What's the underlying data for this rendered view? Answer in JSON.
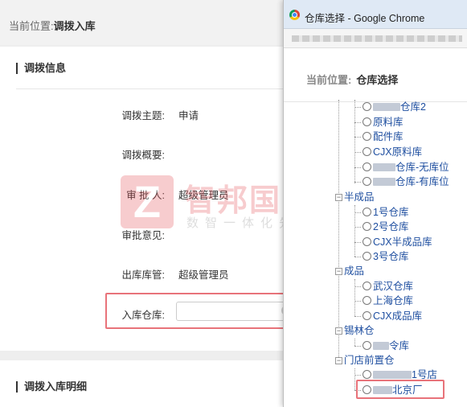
{
  "breadcrumb": {
    "prefix": "当前位置:",
    "current": "调拨入库"
  },
  "section1": {
    "title": "调拨信息"
  },
  "form": [
    {
      "label": "调拨主题:",
      "value": "申请"
    },
    {
      "label": "调拨概要:",
      "value": ""
    },
    {
      "label": "审 批 人:",
      "value": "超级管理员"
    },
    {
      "label": "审批意见:",
      "value": ""
    },
    {
      "label": "出库库管:",
      "value": "超级管理员"
    },
    {
      "label": "入库仓库:",
      "value": ""
    }
  ],
  "section2": {
    "title": "调拨入库明细"
  },
  "watermark": {
    "logo": "Z",
    "name": "智邦国际",
    "slogan": "数智一体化先行者"
  },
  "popup": {
    "window_title": "仓库选择 - Google Chrome",
    "crumb_prefix": "当前位置:",
    "crumb_current": "仓库选择",
    "tree": {
      "g0_items": [
        "仓库2",
        "原料库",
        "配件库",
        "CJX原料库",
        "仓库-无库位",
        "仓库-有库位"
      ],
      "g1_name": "半成品",
      "g1_items": [
        "1号仓库",
        "2号仓库",
        "CJX半成品库",
        "3号仓库"
      ],
      "g2_name": "成品",
      "g2_items": [
        "武汉仓库",
        "上海仓库",
        "CJX成品库"
      ],
      "g3_name": "锡林仓",
      "g3_items": [
        "令库"
      ],
      "g4_name": "门店前置仓",
      "g4_items": [
        "1号店",
        "北京厂"
      ]
    }
  },
  "colors": {
    "accent_link": "#1f4fa0",
    "highlight_box": "#e8737a",
    "watermark": "#e34a52"
  }
}
